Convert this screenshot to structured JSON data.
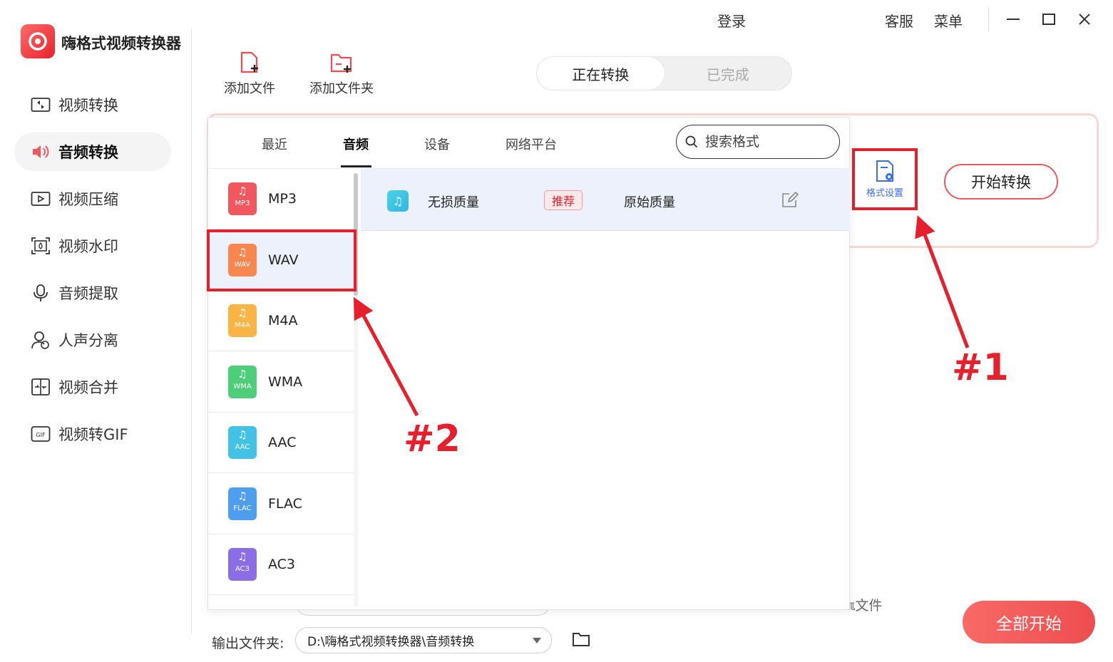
{
  "app": {
    "name": "嗨格式视频转换器"
  },
  "sidebar": {
    "items": [
      {
        "label": "视频转换",
        "icon": "video-convert-icon",
        "active": false
      },
      {
        "label": "音频转换",
        "icon": "audio-convert-icon",
        "active": true
      },
      {
        "label": "视频压缩",
        "icon": "video-compress-icon",
        "active": false
      },
      {
        "label": "视频水印",
        "icon": "video-watermark-icon",
        "active": false
      },
      {
        "label": "音频提取",
        "icon": "audio-extract-icon",
        "active": false
      },
      {
        "label": "人声分离",
        "icon": "vocal-separate-icon",
        "active": false
      },
      {
        "label": "视频合并",
        "icon": "video-merge-icon",
        "active": false
      },
      {
        "label": "视频转GIF",
        "icon": "video-gif-icon",
        "active": false
      }
    ]
  },
  "topbar": {
    "login": "登录",
    "service": "客服",
    "menu": "菜单"
  },
  "toolbar": {
    "add_file": "添加文件",
    "add_folder": "添加文件夹"
  },
  "status_tabs": {
    "converting": "正在转换",
    "done": "已完成"
  },
  "task": {
    "format_settings": "格式设置",
    "start_convert": "开始转换"
  },
  "format_panel": {
    "tabs": [
      "最近",
      "音频",
      "设备",
      "网络平台"
    ],
    "active_tab": "音频",
    "search": {
      "placeholder": "搜索格式",
      "value": ""
    },
    "formats": [
      {
        "name": "MP3",
        "tag": "MP3",
        "color": "#f0575f"
      },
      {
        "name": "WAV",
        "tag": "WAV",
        "color": "#f7874f",
        "selected": true
      },
      {
        "name": "M4A",
        "tag": "M4A",
        "color": "#f8b445"
      },
      {
        "name": "WMA",
        "tag": "WMA",
        "color": "#4dcf7a"
      },
      {
        "name": "AAC",
        "tag": "AAC",
        "color": "#43c2e6"
      },
      {
        "name": "FLAC",
        "tag": "FLAC",
        "color": "#4f9ded"
      },
      {
        "name": "AC3",
        "tag": "AC3",
        "color": "#8b6de6"
      }
    ],
    "quality": {
      "name": "无损质量",
      "badge": "推荐",
      "desc": "原始质量"
    }
  },
  "bottom": {
    "output_label": "输出文件夹:",
    "output_path": "D:\\嗨格式视频转换器\\音频转换",
    "trailing_text": "ℼ文件",
    "start_all": "全部开始"
  },
  "annotations": {
    "one": "#1",
    "two": "#2",
    "color": "#e5202c"
  },
  "colors": {
    "accent": "#e5202c",
    "primary_blue": "#3a6ee8"
  }
}
